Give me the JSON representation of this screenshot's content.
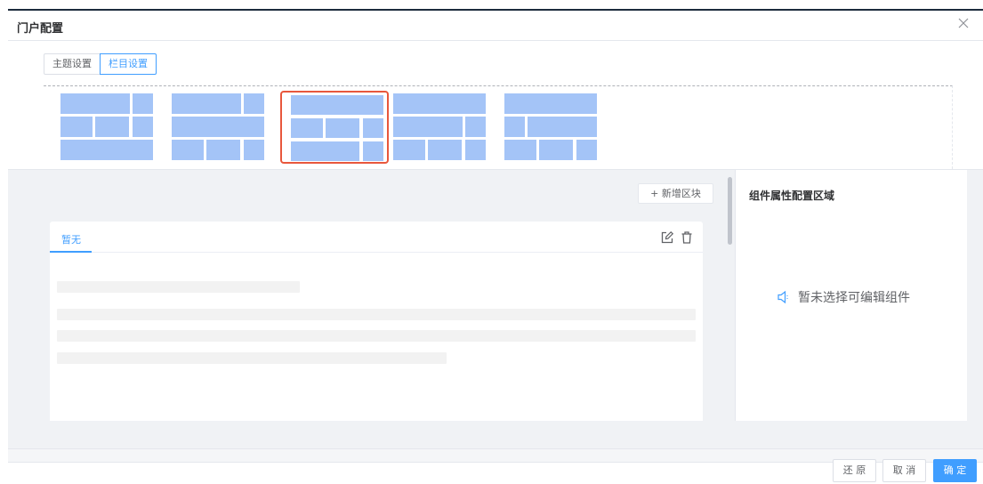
{
  "dialog": {
    "title": "门户配置",
    "close_icon": "close-icon"
  },
  "tabs": [
    {
      "label": "主题设置",
      "active": false
    },
    {
      "label": "栏目设置",
      "active": true
    }
  ],
  "layouts": {
    "count": 5,
    "selected_index": 2,
    "block_color": "#a4c4f7",
    "selected_border_color": "#e8573c"
  },
  "toolbar": {
    "add_block_label": "+ 新增区块"
  },
  "card": {
    "tab_label": "暂无",
    "edit_icon": "edit-icon",
    "delete_icon": "trash-icon"
  },
  "properties_panel": {
    "title": "组件属性配置区域",
    "empty_icon": "speaker-icon",
    "empty_text": "暂未选择可编辑组件"
  },
  "footer": {
    "restore_label": "还 原",
    "cancel_label": "取 消",
    "confirm_label": "确 定"
  },
  "colors": {
    "primary": "#409eff",
    "accent_red": "#e8573c",
    "background": "#f0f2f5"
  }
}
